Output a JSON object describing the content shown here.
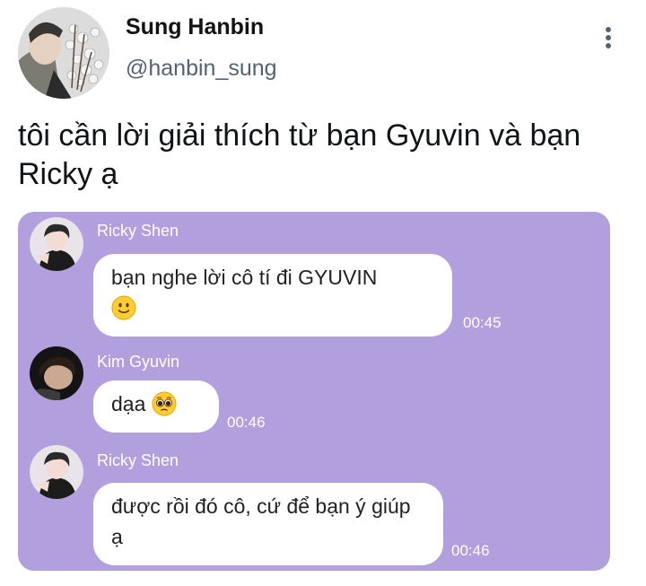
{
  "tweet": {
    "display_name": "Sung Hanbin",
    "handle": "@hanbin_sung",
    "text": "tôi cần lời giải thích từ bạn Gyuvin và bạn Ricky ạ"
  },
  "chat": {
    "background_color": "#b29fde",
    "messages": [
      {
        "sender": "Ricky Shen",
        "text": "bạn nghe lời cô tí đi GYUVIN",
        "emoji": "slightly-smiling-face-emoji",
        "time": "00:45"
      },
      {
        "sender": "Kim Gyuvin",
        "text": "dạa",
        "emoji": "pleading-face-emoji",
        "time": "00:46"
      },
      {
        "sender": "Ricky Shen",
        "text": "được rồi đó cô, cứ để bạn ý giúp ạ",
        "time": "00:46"
      }
    ]
  }
}
